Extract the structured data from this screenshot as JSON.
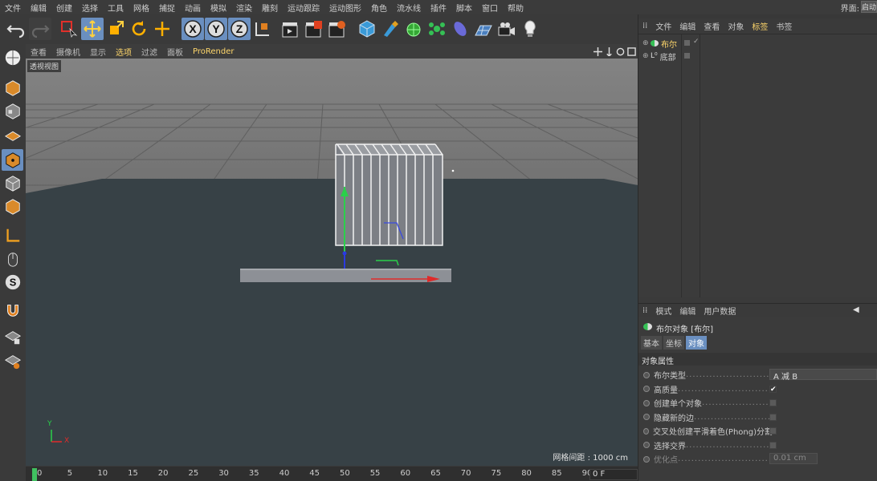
{
  "menubar": {
    "items": [
      "文件",
      "编辑",
      "创建",
      "选择",
      "工具",
      "网格",
      "捕捉",
      "动画",
      "模拟",
      "渲染",
      "雕刻",
      "运动跟踪",
      "运动图形",
      "角色",
      "流水线",
      "插件",
      "脚本",
      "窗口",
      "帮助"
    ],
    "layout_label": "界面:",
    "layout_value": "启动"
  },
  "viewport": {
    "menu": [
      "查看",
      "摄像机",
      "显示",
      "选项",
      "过滤",
      "面板",
      "ProRender"
    ],
    "label": "透视视图",
    "grid_label": "网格间距 : 1000 cm",
    "axis_y": "Y",
    "axis_x": "X"
  },
  "timeline": {
    "ticks": [
      "0",
      "5",
      "10",
      "15",
      "20",
      "25",
      "30",
      "35",
      "40",
      "45",
      "50",
      "55",
      "60",
      "65",
      "70",
      "75",
      "80",
      "85",
      "90"
    ],
    "frame": "0 F"
  },
  "object_manager": {
    "menu": [
      "文件",
      "编辑",
      "查看",
      "对象",
      "标签",
      "书签"
    ],
    "objects": [
      {
        "name": "布尔",
        "selected": true
      },
      {
        "name": "底部",
        "selected": false
      }
    ]
  },
  "attributes": {
    "menu": [
      "模式",
      "编辑",
      "用户数据"
    ],
    "object_title": "布尔对象 [布尔]",
    "tabs": [
      "基本",
      "坐标",
      "对象"
    ],
    "section": "对象属性",
    "rows": [
      {
        "label": "布尔类型",
        "value": "A 减 B",
        "type": "select"
      },
      {
        "label": "高质量",
        "value": "✔",
        "type": "check"
      },
      {
        "label": "创建单个对象",
        "value": "",
        "type": "check"
      },
      {
        "label": "隐藏新的边",
        "value": "",
        "type": "check"
      },
      {
        "label": "交叉处创建平滑着色(Phong)分割",
        "value": "",
        "type": "check"
      },
      {
        "label": "选择交界",
        "value": "",
        "type": "check"
      },
      {
        "label": "优化点",
        "value": "0.01 cm",
        "type": "number"
      }
    ]
  }
}
